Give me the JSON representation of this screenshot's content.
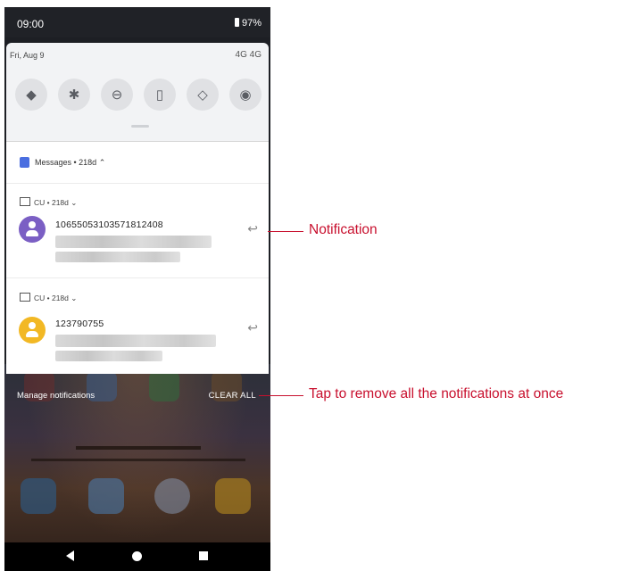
{
  "status_bar": {
    "time": "09:00",
    "battery": "97%"
  },
  "quick_settings": {
    "date": "Fri, Aug 9",
    "signal": "4G 4G",
    "tiles": [
      {
        "name": "wifi",
        "glyph": "◆"
      },
      {
        "name": "bluetooth",
        "glyph": "✱"
      },
      {
        "name": "do-not-disturb",
        "glyph": "⊖"
      },
      {
        "name": "flashlight",
        "glyph": "▯"
      },
      {
        "name": "auto-rotate",
        "glyph": "◇"
      },
      {
        "name": "hotspot",
        "glyph": "◉"
      }
    ]
  },
  "group": {
    "label": "Messages • 218d ⌃"
  },
  "notifications": [
    {
      "sub": "CU • 218d ⌄",
      "title": "10655053103571812408",
      "avatar_color": "#7b5fc4"
    },
    {
      "sub": "CU • 218d ⌄",
      "title": "123790755",
      "avatar_color": "#f2b824"
    }
  ],
  "actions": {
    "manage": "Manage notifications",
    "clear_all": "CLEAR ALL"
  },
  "callouts": {
    "notification": "Notification",
    "clear_all": "Tap to remove all the notifications at once"
  },
  "colors": {
    "accent": "#c8102e"
  }
}
